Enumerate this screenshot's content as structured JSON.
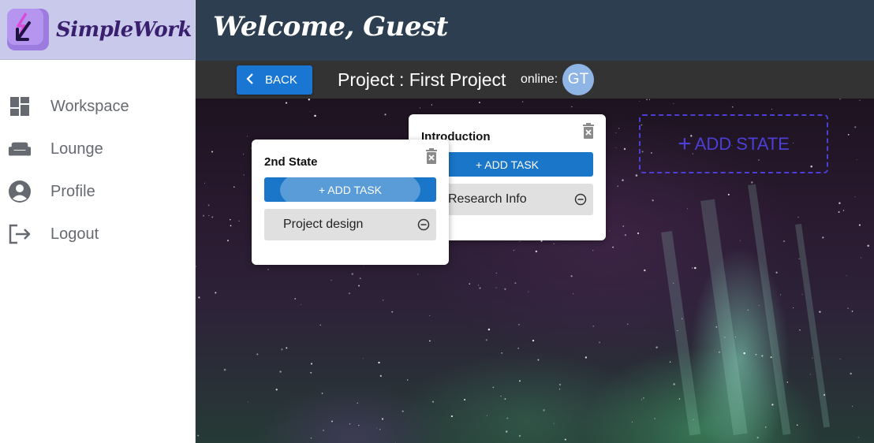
{
  "brand": {
    "name": "SimpleWork",
    "logo_icon": "lightning-arrow-icon"
  },
  "sidebar": {
    "items": [
      {
        "label": "Workspace",
        "icon": "dashboard-icon"
      },
      {
        "label": "Lounge",
        "icon": "sofa-icon"
      },
      {
        "label": "Profile",
        "icon": "account-circle-icon"
      },
      {
        "label": "Logout",
        "icon": "logout-icon"
      }
    ]
  },
  "header": {
    "welcome": "Welcome, Guest"
  },
  "project_bar": {
    "back_label": "BACK",
    "title": "Project : First Project",
    "online_label": "online:",
    "online_users": [
      "GT"
    ]
  },
  "board": {
    "states": [
      {
        "title": "2nd State",
        "add_task_label": "+ ADD TASK",
        "tasks": [
          "Project design"
        ]
      },
      {
        "title": "Introduction",
        "add_task_label": "+ ADD TASK",
        "tasks": [
          "Research Info"
        ]
      }
    ],
    "add_state_label": "ADD STATE",
    "add_state_plus": "+"
  },
  "colors": {
    "sidebar_brand_bg": "#c9c9ec",
    "topbar_bg": "#2c3e50",
    "projbar_bg": "#333333",
    "primary_button": "#1976d2",
    "add_state_accent": "#4b3fd6",
    "task_bg": "#e0e0e0"
  }
}
